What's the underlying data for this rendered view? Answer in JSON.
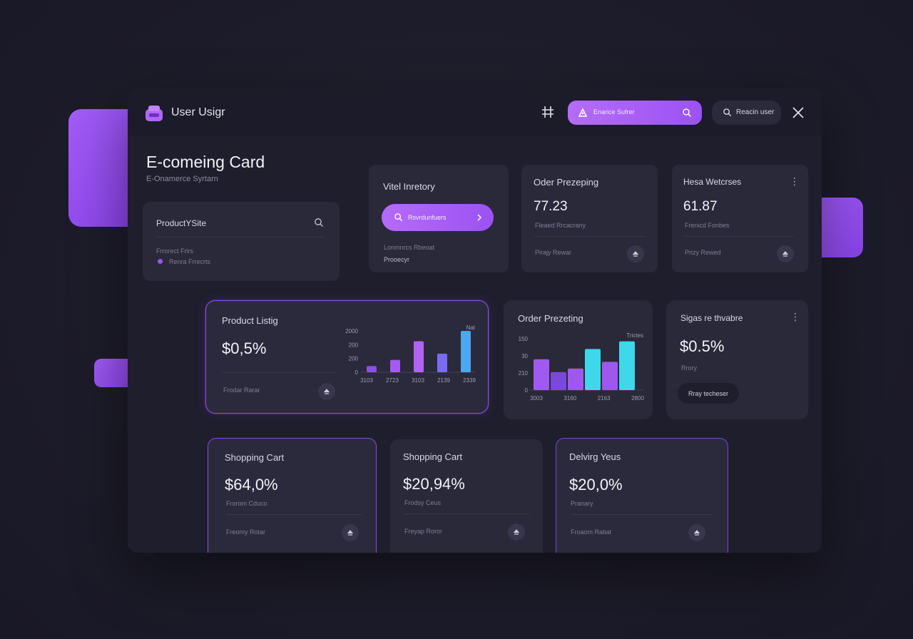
{
  "app": {
    "title": "User Usigr"
  },
  "header": {
    "search_pill_text": "Enarice Sufrer",
    "ghost_button_label": "Reacin user"
  },
  "page": {
    "title": "E-comeing Card",
    "subtitle": "E-Onamerce Syrtarn"
  },
  "search_card": {
    "label": "ProductYSite",
    "line1": "Frrorect Frirs",
    "line2": "Renra Frrecrts"
  },
  "vitel_card": {
    "title": "Vitel Inretory",
    "button_label": "Rsvrdunfuers",
    "line1": "Lonmnrcs Rbeoat",
    "line2": "Prooecyr"
  },
  "order_top": {
    "title": "Oder Prezeping",
    "value": "77.23",
    "caption": "Fleaed Rrcacrany",
    "footer": "Pirajy Rewar"
  },
  "hesa_card": {
    "title": "Hesa Wetcrses",
    "value": "61.87",
    "caption": "Frenicd Fonbes",
    "footer": "Prizy Rewed"
  },
  "product_card": {
    "title": "Product Listig",
    "value": "$0,5%",
    "footer": "Frodar Rarar"
  },
  "order_mid": {
    "title": "Order Prezeting"
  },
  "sigas_card": {
    "title": "Sigas re thvabre",
    "value": "$0.5%",
    "caption": "Rrory",
    "button_label": "Rray techeser"
  },
  "cart_a": {
    "title": "Shopping Cart",
    "value": "$64,0%",
    "caption": "Frorom Cduco",
    "footer": "Freomy Rotar"
  },
  "cart_b": {
    "title": "Shopping Cart",
    "value": "$20,94%",
    "caption": "Frodsy Ceus",
    "footer": "Freyap Roror"
  },
  "delivery_card": {
    "title": "Delvirg Yeus",
    "value": "$20,0%",
    "caption": "Pranary",
    "footer": "Froaom Ratiat"
  },
  "colors": {
    "accent": "#9b52f2",
    "accent_light": "#b66cf9",
    "cyan": "#3fd7ea",
    "card": "#2a2939",
    "window": "#1f1e2d"
  },
  "chart_data": [
    {
      "type": "bar",
      "legend_text": "Nat",
      "yticks": [
        "2000",
        "200",
        "200",
        "0"
      ],
      "categories": [
        "3103",
        "2723",
        "3103",
        "2139",
        "2339"
      ],
      "values": [
        0.15,
        0.3,
        0.75,
        0.45,
        1.0
      ],
      "colors": [
        "#8d4fe0",
        "#a55bef",
        "#b164f2",
        "#7a6bf3",
        "#4ba7ee"
      ],
      "ylim": [
        0,
        1
      ]
    },
    {
      "type": "bar",
      "legend_text": "Trictes",
      "yticks": [
        "150",
        "30",
        "210",
        "0"
      ],
      "categories": [
        "3003",
        "3160",
        "2163",
        "2800"
      ],
      "values": [
        0.6,
        0.35,
        0.42,
        0.8,
        0.55,
        0.95
      ],
      "colors": [
        "#a05aef",
        "#7b49d9",
        "#9e58ee",
        "#3fd7ea",
        "#9e58ee",
        "#3fd7ea"
      ],
      "ylim": [
        0,
        1
      ]
    }
  ]
}
